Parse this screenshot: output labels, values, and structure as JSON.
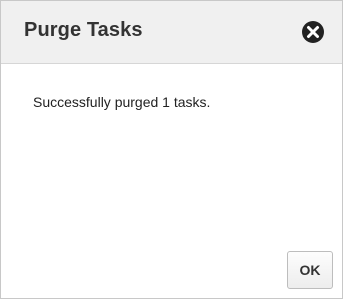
{
  "dialog": {
    "title": "Purge Tasks",
    "close_icon": "close-icon",
    "message": "Successfully purged 1 tasks.",
    "ok_label": "OK"
  },
  "colors": {
    "header_background": "#f0f0f0",
    "close_icon_fill": "#222222",
    "border": "#c8c8c8"
  }
}
